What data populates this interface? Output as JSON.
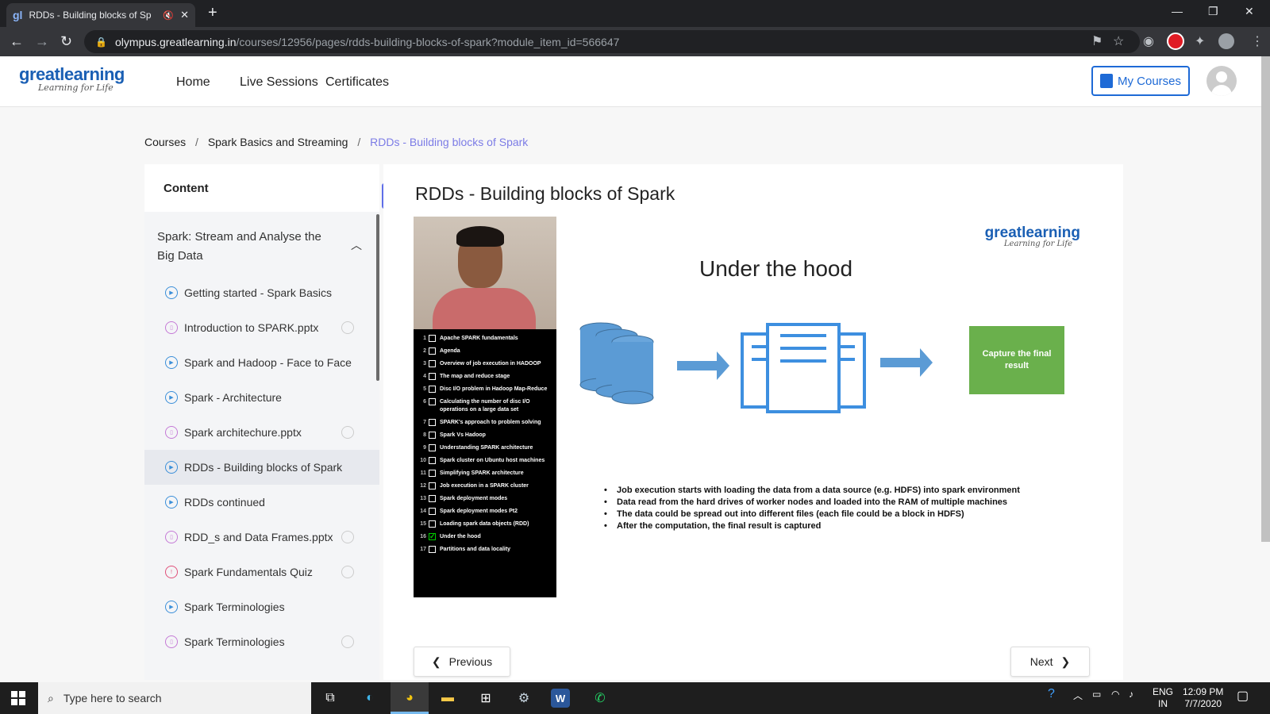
{
  "browser": {
    "tab_title": "RDDs - Building blocks of Sp",
    "tab_favicon": "gl",
    "url_host": "olympus.greatlearning.in",
    "url_path": "/courses/12956/pages/rdds-building-blocks-of-spark?module_item_id=566647"
  },
  "header": {
    "logo_main": "greatlearning",
    "logo_sub": "Learning for Life",
    "nav": [
      "Home",
      "Live Sessions",
      "Certificates"
    ],
    "my_courses": "My Courses"
  },
  "breadcrumb": {
    "items": [
      "Courses",
      "Spark Basics and Streaming",
      "RDDs - Building blocks of Spark"
    ],
    "sep": "/"
  },
  "sidebar": {
    "heading": "Content",
    "module_title": "Spark: Stream and Analyse the Big Data",
    "items": [
      {
        "label": "Getting started - Spark Basics",
        "type": "video",
        "check": false
      },
      {
        "label": "Introduction to SPARK.pptx",
        "type": "doc",
        "check": true
      },
      {
        "label": "Spark and Hadoop - Face to Face",
        "type": "video",
        "check": false
      },
      {
        "label": "Spark - Architecture",
        "type": "video",
        "check": false
      },
      {
        "label": "Spark architechure.pptx",
        "type": "doc",
        "check": true
      },
      {
        "label": "RDDs - Building blocks of Spark",
        "type": "video",
        "check": false,
        "active": true
      },
      {
        "label": "RDDs continued",
        "type": "video",
        "check": false
      },
      {
        "label": "RDD_s and Data Frames.pptx",
        "type": "doc",
        "check": true
      },
      {
        "label": "Spark Fundamentals Quiz",
        "type": "quiz",
        "check": true
      },
      {
        "label": "Spark Terminologies",
        "type": "video",
        "check": false
      },
      {
        "label": "Spark Terminologies",
        "type": "doc",
        "check": true
      }
    ]
  },
  "main": {
    "title": "RDDs - Building blocks of Spark",
    "slide": {
      "logo_main": "greatlearning",
      "logo_sub": "Learning for Life",
      "heading": "Under the hood",
      "capture_label": "Capture the final result",
      "bullets": [
        "Job execution starts with loading the data from a data source (e.g. HDFS) into spark environment",
        "Data read from the hard drives of worker nodes  and  loaded into the RAM of multiple machines",
        "The data could be spread out into different files (each file could be a block in HDFS)",
        "After the computation, the final result is captured"
      ],
      "toc": [
        {
          "n": "1",
          "t": "Apache SPARK fundamentals"
        },
        {
          "n": "2",
          "t": "Agenda"
        },
        {
          "n": "3",
          "t": "Overview of job execution in HADOOP"
        },
        {
          "n": "4",
          "t": "The map and reduce stage"
        },
        {
          "n": "5",
          "t": "Disc I/O problem in Hadoop Map-Reduce"
        },
        {
          "n": "6",
          "t": "Calculating the number of disc I/O operations on a large data set"
        },
        {
          "n": "7",
          "t": "SPARK's approach to problem solving"
        },
        {
          "n": "8",
          "t": "Spark Vs Hadoop"
        },
        {
          "n": "9",
          "t": "Understanding SPARK architecture"
        },
        {
          "n": "10",
          "t": "Spark cluster on Ubuntu host machines"
        },
        {
          "n": "11",
          "t": "Simplifying SPARK architecture"
        },
        {
          "n": "12",
          "t": "Job execution in a SPARK cluster"
        },
        {
          "n": "13",
          "t": "Spark deployment modes"
        },
        {
          "n": "14",
          "t": "Spark deployment modes Pt2"
        },
        {
          "n": "15",
          "t": "Loading spark data objects (RDD)"
        },
        {
          "n": "16",
          "t": "Under the hood",
          "checked": true
        },
        {
          "n": "17",
          "t": "Partitions and data locality"
        }
      ]
    },
    "prev": "Previous",
    "next": "Next"
  },
  "taskbar": {
    "search_placeholder": "Type here to search",
    "lang_top": "ENG",
    "lang_bottom": "IN",
    "time": "12:09 PM",
    "date": "7/7/2020"
  },
  "colors": {
    "accent": "#5f6ee8",
    "brand": "#1a5fb4",
    "capture": "#6ab04c",
    "diagram": "#5b9bd5"
  }
}
